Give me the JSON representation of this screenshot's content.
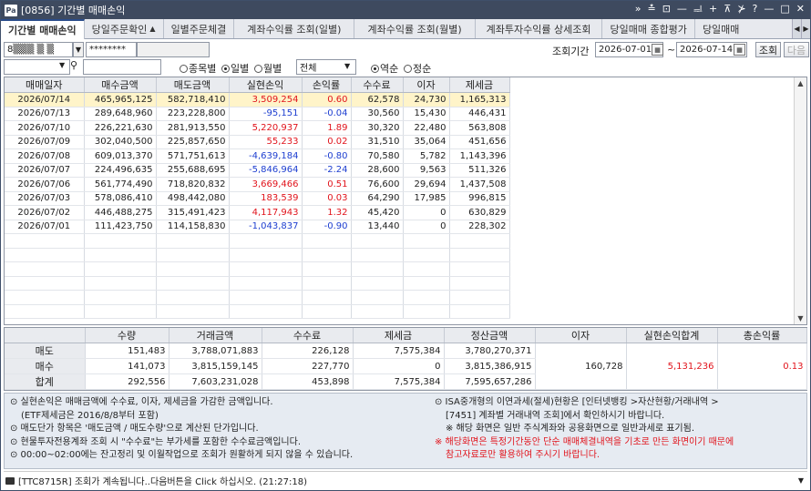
{
  "window": {
    "icon_text": "Pa",
    "title": "[0856] 기간별 매매손익",
    "tools": [
      "»",
      "≛",
      "⊡",
      "—",
      "ᆗ",
      "+",
      "⊼",
      "⊁",
      "?",
      "—",
      "□",
      "✕"
    ]
  },
  "tabs": [
    "기간별 매매손익",
    "당일주문확인",
    "일별주문체결",
    "계좌수익률 조회(일별)",
    "계좌수익률 조회(월별)",
    "계좌투자수익률 상세조회",
    "당일매매 종합평가",
    "당일매매"
  ],
  "controls": {
    "account": "8▒▒▒ ▒ ▒",
    "password": "********",
    "period_label": "조회기간",
    "date_from": "2026-07-01",
    "date_sep": "~",
    "date_to": "2026-07-14",
    "query_button": "조회",
    "next_button": "다음",
    "radio_item": "종목별",
    "radio_daily": "일별",
    "radio_monthly": "월별",
    "filter_value": "전체",
    "radio_desc": "역순",
    "radio_asc": "정순"
  },
  "grid": {
    "headers": [
      "매매일자",
      "매수금액",
      "매도금액",
      "실현손익",
      "손익률",
      "수수료",
      "이자",
      "제세금"
    ],
    "rows": [
      [
        "2026/07/14",
        "465,965,125",
        "582,718,410",
        "3,509,254",
        "0.60",
        "62,578",
        "24,730",
        "1,165,313"
      ],
      [
        "2026/07/13",
        "289,648,960",
        "223,228,800",
        "-95,151",
        "-0.04",
        "30,560",
        "15,430",
        "446,431"
      ],
      [
        "2026/07/10",
        "226,221,630",
        "281,913,550",
        "5,220,937",
        "1.89",
        "30,320",
        "22,480",
        "563,808"
      ],
      [
        "2026/07/09",
        "302,040,500",
        "225,857,650",
        "55,233",
        "0.02",
        "31,510",
        "35,064",
        "451,656"
      ],
      [
        "2026/07/08",
        "609,013,370",
        "571,751,613",
        "-4,639,184",
        "-0.80",
        "70,580",
        "5,782",
        "1,143,396"
      ],
      [
        "2026/07/07",
        "224,496,635",
        "255,688,695",
        "-5,846,964",
        "-2.24",
        "28,600",
        "9,563",
        "511,326"
      ],
      [
        "2026/07/06",
        "561,774,490",
        "718,820,832",
        "3,669,466",
        "0.51",
        "76,600",
        "29,694",
        "1,437,508"
      ],
      [
        "2026/07/03",
        "578,086,410",
        "498,442,080",
        "183,539",
        "0.03",
        "64,290",
        "17,985",
        "996,815"
      ],
      [
        "2026/07/02",
        "446,488,275",
        "315,491,423",
        "4,117,943",
        "1.32",
        "45,420",
        "0",
        "630,829"
      ],
      [
        "2026/07/01",
        "111,423,750",
        "114,158,830",
        "-1,043,837",
        "-0.90",
        "13,440",
        "0",
        "228,302"
      ]
    ]
  },
  "summary": {
    "headers": [
      "수량",
      "거래금액",
      "수수료",
      "제세금",
      "정산금액",
      "이자",
      "실현손익합계",
      "총손익률"
    ],
    "rows": [
      {
        "label": "매도",
        "qty": "151,483",
        "amount": "3,788,071,883",
        "fee": "226,128",
        "tax": "7,575,384",
        "settle": "3,780,270,371"
      },
      {
        "label": "매수",
        "qty": "141,073",
        "amount": "3,815,159,145",
        "fee": "227,770",
        "tax": "0",
        "settle": "3,815,386,915"
      },
      {
        "label": "합계",
        "qty": "292,556",
        "amount": "7,603,231,028",
        "fee": "453,898",
        "tax": "7,575,384",
        "settle": "7,595,657,286"
      }
    ],
    "interest": "160,728",
    "realized_total": "5,131,236",
    "total_rate": "0.13"
  },
  "notes": {
    "left": [
      "⊙ 실현손익은 매매금액에 수수료, 이자, 제세금을 가감한 금액입니다.",
      "(ETF제세금은 2016/8/8부터 포함)",
      "⊙ 매도단가 항목은 '매도금액 / 매도수량'으로 계산된 단가입니다.",
      "⊙ 현물투자전용계좌 조회 시 \"수수료\"는 부가세를 포함한 수수료금액입니다.",
      "⊙ 00:00~02:00에는 잔고정리 및 이월작업으로 조회가 원활하게 되지 않을 수 있습니다."
    ],
    "right": [
      "⊙ ISA중개형의 이연과세(절세)현황은 [인터넷뱅킹 >자산현황/거래내역 >",
      "[7451] 계좌별 거래내역 조회]에서 확인하시기 바랍니다.",
      "※ 해당 화면은 일반 주식계좌와 공용화면으로 일반과세로 표기됨."
    ],
    "right_red": [
      "※ 해당화면은 특정기간동안 단순 매매체결내역을 기초로 만든 화면이기 때문에",
      "참고자료로만 활용하여 주시기 바랍니다."
    ]
  },
  "status": "[TTC8715R] 조회가 계속됩니다..다음버튼을 Click 하십시오. (21:27:18)",
  "colors": {
    "positive": "#e1141c",
    "negative": "#1e3fd0",
    "selected_row": "#fff4c9",
    "titlebar": "#3e4a5f"
  }
}
